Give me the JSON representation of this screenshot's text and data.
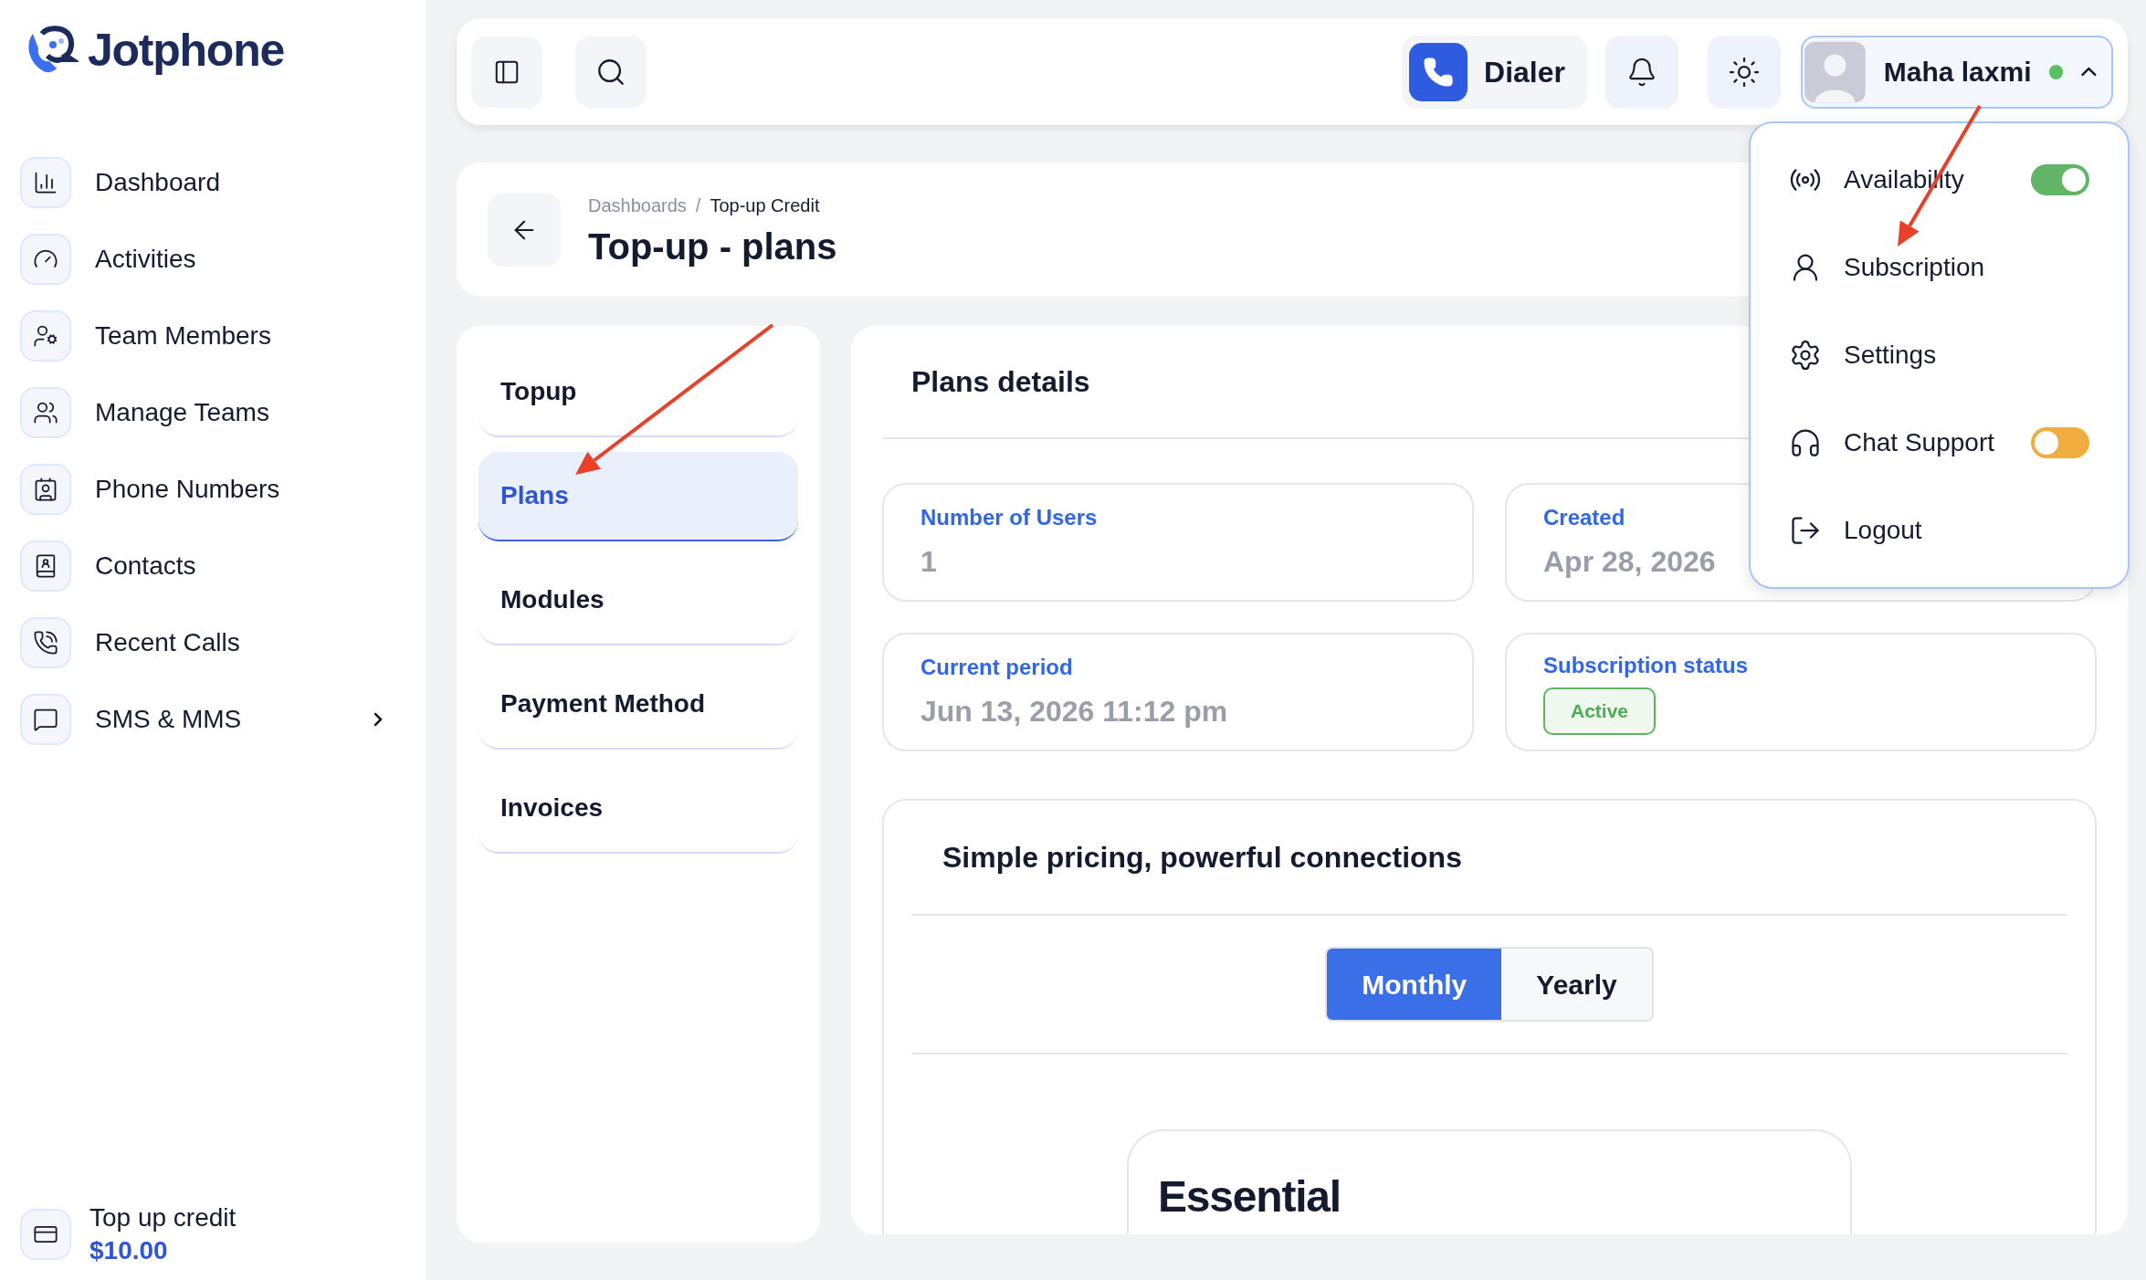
{
  "brand": {
    "name": "Jotphone"
  },
  "sidebar": {
    "items": [
      {
        "label": "Dashboard",
        "expandable": false
      },
      {
        "label": "Activities",
        "expandable": false
      },
      {
        "label": "Team Members",
        "expandable": false
      },
      {
        "label": "Manage Teams",
        "expandable": false
      },
      {
        "label": "Phone Numbers",
        "expandable": false
      },
      {
        "label": "Contacts",
        "expandable": false
      },
      {
        "label": "Recent Calls",
        "expandable": false
      },
      {
        "label": "SMS & MMS",
        "expandable": true
      }
    ],
    "credit": {
      "label": "Top up credit",
      "amount": "$10.00"
    }
  },
  "header": {
    "dialer": "Dialer",
    "user": {
      "name": "Maha laxmi",
      "online": true,
      "expanded": true
    }
  },
  "user_menu": {
    "items": [
      {
        "label": "Availability",
        "kind": "toggle",
        "on": true
      },
      {
        "label": "Subscription",
        "kind": "link"
      },
      {
        "label": "Settings",
        "kind": "link"
      },
      {
        "label": "Chat Support",
        "kind": "toggle",
        "on": false
      },
      {
        "label": "Logout",
        "kind": "link"
      }
    ]
  },
  "breadcrumb": [
    "Dashboards",
    "Top-up Credit"
  ],
  "breadcrumb_separator": "/",
  "page_title": "Top-up - plans",
  "tabs": [
    {
      "label": "Topup",
      "selected": false
    },
    {
      "label": "Plans",
      "selected": true
    },
    {
      "label": "Modules",
      "selected": false
    },
    {
      "label": "Payment Method",
      "selected": false
    },
    {
      "label": "Invoices",
      "selected": false
    }
  ],
  "details": {
    "title": "Plans details",
    "fields": [
      {
        "label": "Number of Users",
        "kind": "text",
        "value": "1"
      },
      {
        "label": "Created",
        "kind": "text",
        "value": "Apr 28, 2026"
      },
      {
        "label": "Current period",
        "kind": "text",
        "value": "Jun 13, 2026 11:12 pm"
      },
      {
        "label": "Subscription status",
        "kind": "badge",
        "value": "Active"
      }
    ]
  },
  "pricing": {
    "title": "Simple pricing, powerful connections",
    "billing": [
      {
        "label": "Monthly",
        "selected": true
      },
      {
        "label": "Yearly",
        "selected": false
      }
    ],
    "plans": [
      {
        "name": "Essential"
      }
    ]
  }
}
